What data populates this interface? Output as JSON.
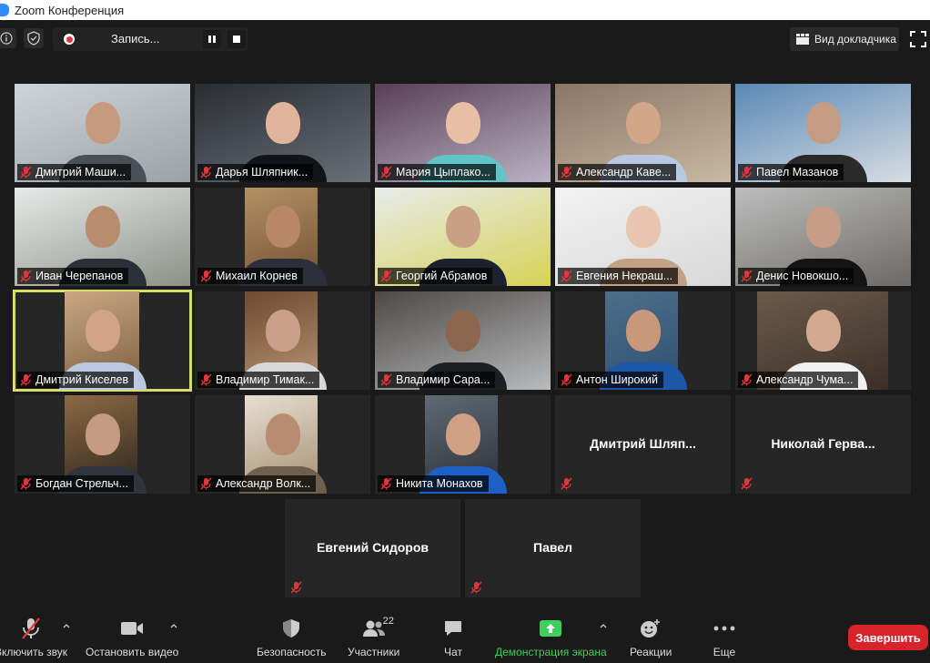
{
  "window": {
    "title": "Zoom Конференция"
  },
  "topbar": {
    "recording_label": "Запись...",
    "speaker_view_label": "Вид докладчика"
  },
  "participants": [
    {
      "name": "Дмитрий Маши..."
    },
    {
      "name": "Дарья Шляпник..."
    },
    {
      "name": "Мария Цыплако..."
    },
    {
      "name": "Александр Кавe..."
    },
    {
      "name": "Павел Мазанов"
    },
    {
      "name": "Иван Черепанов"
    },
    {
      "name": "Михаил Корнев"
    },
    {
      "name": "Георгий Абрамов"
    },
    {
      "name": "Евгения Некраш..."
    },
    {
      "name": "Денис Новокшо..."
    },
    {
      "name": "Дмитрий Киселев"
    },
    {
      "name": "Владимир Тимак..."
    },
    {
      "name": "Владимир Сара..."
    },
    {
      "name": "Антон Широкий"
    },
    {
      "name": "Александр Чума..."
    },
    {
      "name": "Богдан Стрельч..."
    },
    {
      "name": "Александр Волк..."
    },
    {
      "name": "Никита Монахов"
    },
    {
      "name": "Дмитрий  Шляп..."
    },
    {
      "name": "Николай  Герва..."
    },
    {
      "name": "Евгений Сидоров"
    },
    {
      "name": "Павел"
    }
  ],
  "toolbar": {
    "unmute_label": "Включить звук",
    "stop_video_label": "Остановить видео",
    "security_label": "Безопасность",
    "participants_label": "Участники",
    "participants_count": "22",
    "chat_label": "Чат",
    "share_screen_label": "Демонстрация экрана",
    "reactions_label": "Реакции",
    "more_label": "Еще",
    "end_label": "Завершить"
  },
  "colors": {
    "accent_green": "#3fd05b",
    "end_red": "#d8232a",
    "active_speaker": "#d6dd6a",
    "muted_red": "#e0373a"
  }
}
